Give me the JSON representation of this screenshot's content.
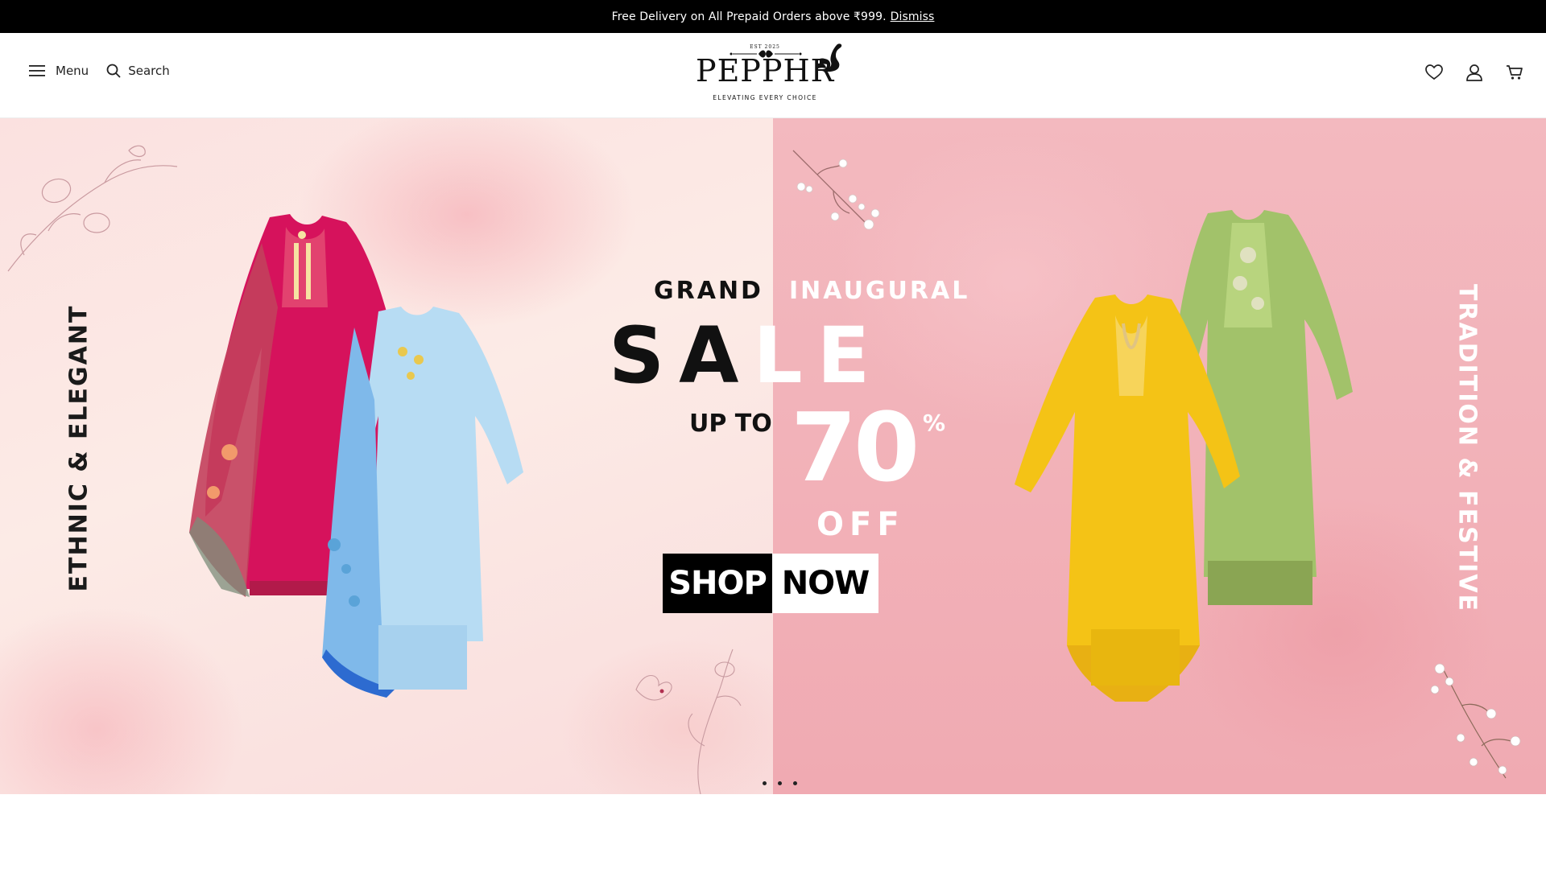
{
  "announcement": {
    "text": "Free Delivery on All Prepaid Orders above ₹999.",
    "dismiss_label": "Dismiss"
  },
  "header": {
    "menu_label": "Menu",
    "search_label": "Search",
    "logo": {
      "est": "EST 2025",
      "brand": "PEPPHR",
      "tagline": "ELEVATING EVERY CHOICE"
    },
    "icons": [
      "heart-icon",
      "user-icon",
      "cart-icon"
    ]
  },
  "hero": {
    "left_side_text": "ETHNIC & ELEGANT",
    "right_side_text": "TRADITION & FESTIVE",
    "grand": "GRAND",
    "inaugural": "INAUGURAL",
    "sale_dark": "SA",
    "sale_light": "LE",
    "up_to": "UP TO",
    "percent_value": "70",
    "percent_sign": "%",
    "off": "OFF",
    "shop_label": "SHOP",
    "now_label": "NOW",
    "slide_count": 3,
    "colors": {
      "left_bg": "#fbe3e0",
      "right_bg": "#f2b3b9",
      "left_dress_magenta": "#d81b60",
      "left_dress_blue": "#8ec5ec",
      "right_dress_yellow": "#f2c318",
      "right_dress_green": "#a8c46c"
    }
  }
}
